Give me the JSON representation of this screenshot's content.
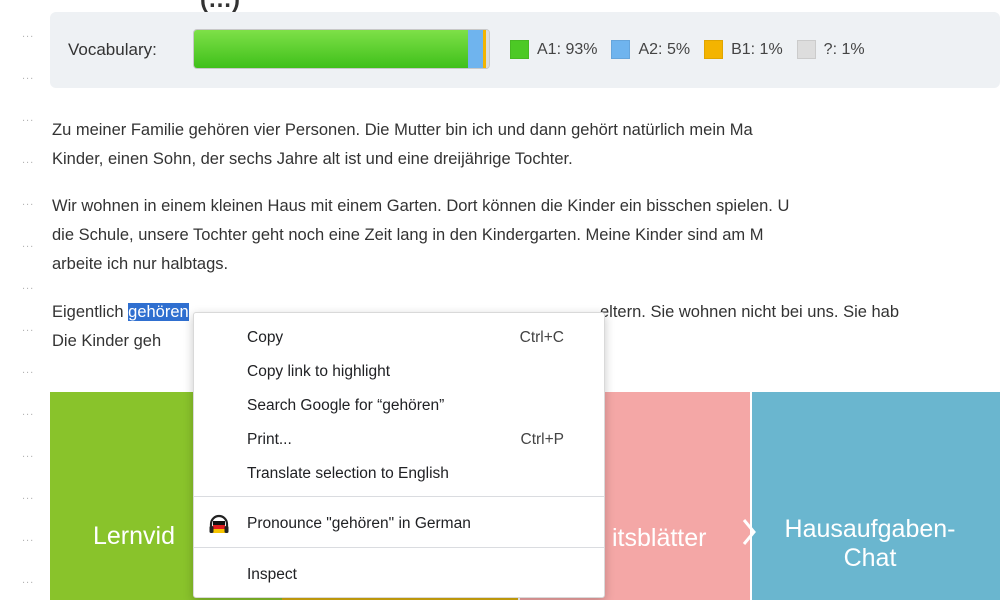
{
  "page": {
    "heading_fragment": "(…)"
  },
  "vocabulary": {
    "label": "Vocabulary:",
    "levels": [
      {
        "key": "a1",
        "label": "A1: 93%",
        "percent": 93,
        "color": "#4cc925"
      },
      {
        "key": "a2",
        "label": "A2: 5%",
        "percent": 5,
        "color": "#6fb4ee"
      },
      {
        "key": "b1",
        "label": "B1: 1%",
        "percent": 1,
        "color": "#f4b400"
      },
      {
        "key": "unknown",
        "label": "?: 1%",
        "percent": 1,
        "color": "#dddddd"
      }
    ]
  },
  "text": {
    "p1_line1": "Zu meiner Familie gehören vier Personen. Die Mutter bin ich und dann gehört natürlich mein Ma",
    "p1_line2": "Kinder, einen Sohn, der sechs Jahre alt ist und eine dreijährige Tochter.",
    "p2_line1": "Wir wohnen in einem kleinen Haus mit einem Garten. Dort können die Kinder ein bisschen spielen. U",
    "p2_line2": "die Schule, unsere Tochter geht noch eine Zeit lang in den Kindergarten. Meine Kinder sind am M",
    "p2_line3": "arbeite ich nur halbtags.",
    "p3_line1_before": "Eigentlich ",
    "p3_selected": "gehören",
    "p3_line1_after": "eltern. Sie wohnen nicht bei uns. Sie hab",
    "p3_line2": "Die Kinder geh"
  },
  "tiles": [
    {
      "key": "lernvideos",
      "label": "Lernvid"
    },
    {
      "key": "arbeitsblaetter",
      "label": "itsblätter"
    },
    {
      "key": "hausaufgaben",
      "label_line1": "Hausaufgaben-",
      "label_line2": "Chat"
    }
  ],
  "context_menu": {
    "items": [
      {
        "key": "copy",
        "label": "Copy",
        "shortcut": "Ctrl+C"
      },
      {
        "key": "copy_link",
        "label": "Copy link to highlight"
      },
      {
        "key": "search_google",
        "label": "Search Google for “gehören”"
      },
      {
        "key": "print",
        "label": "Print...",
        "shortcut": "Ctrl+P"
      },
      {
        "key": "translate",
        "label": "Translate selection to English"
      },
      {
        "key": "pronounce",
        "label": "Pronounce \"gehören\" in German",
        "icon": "headset-icon"
      },
      {
        "key": "inspect",
        "label": "Inspect"
      }
    ]
  }
}
